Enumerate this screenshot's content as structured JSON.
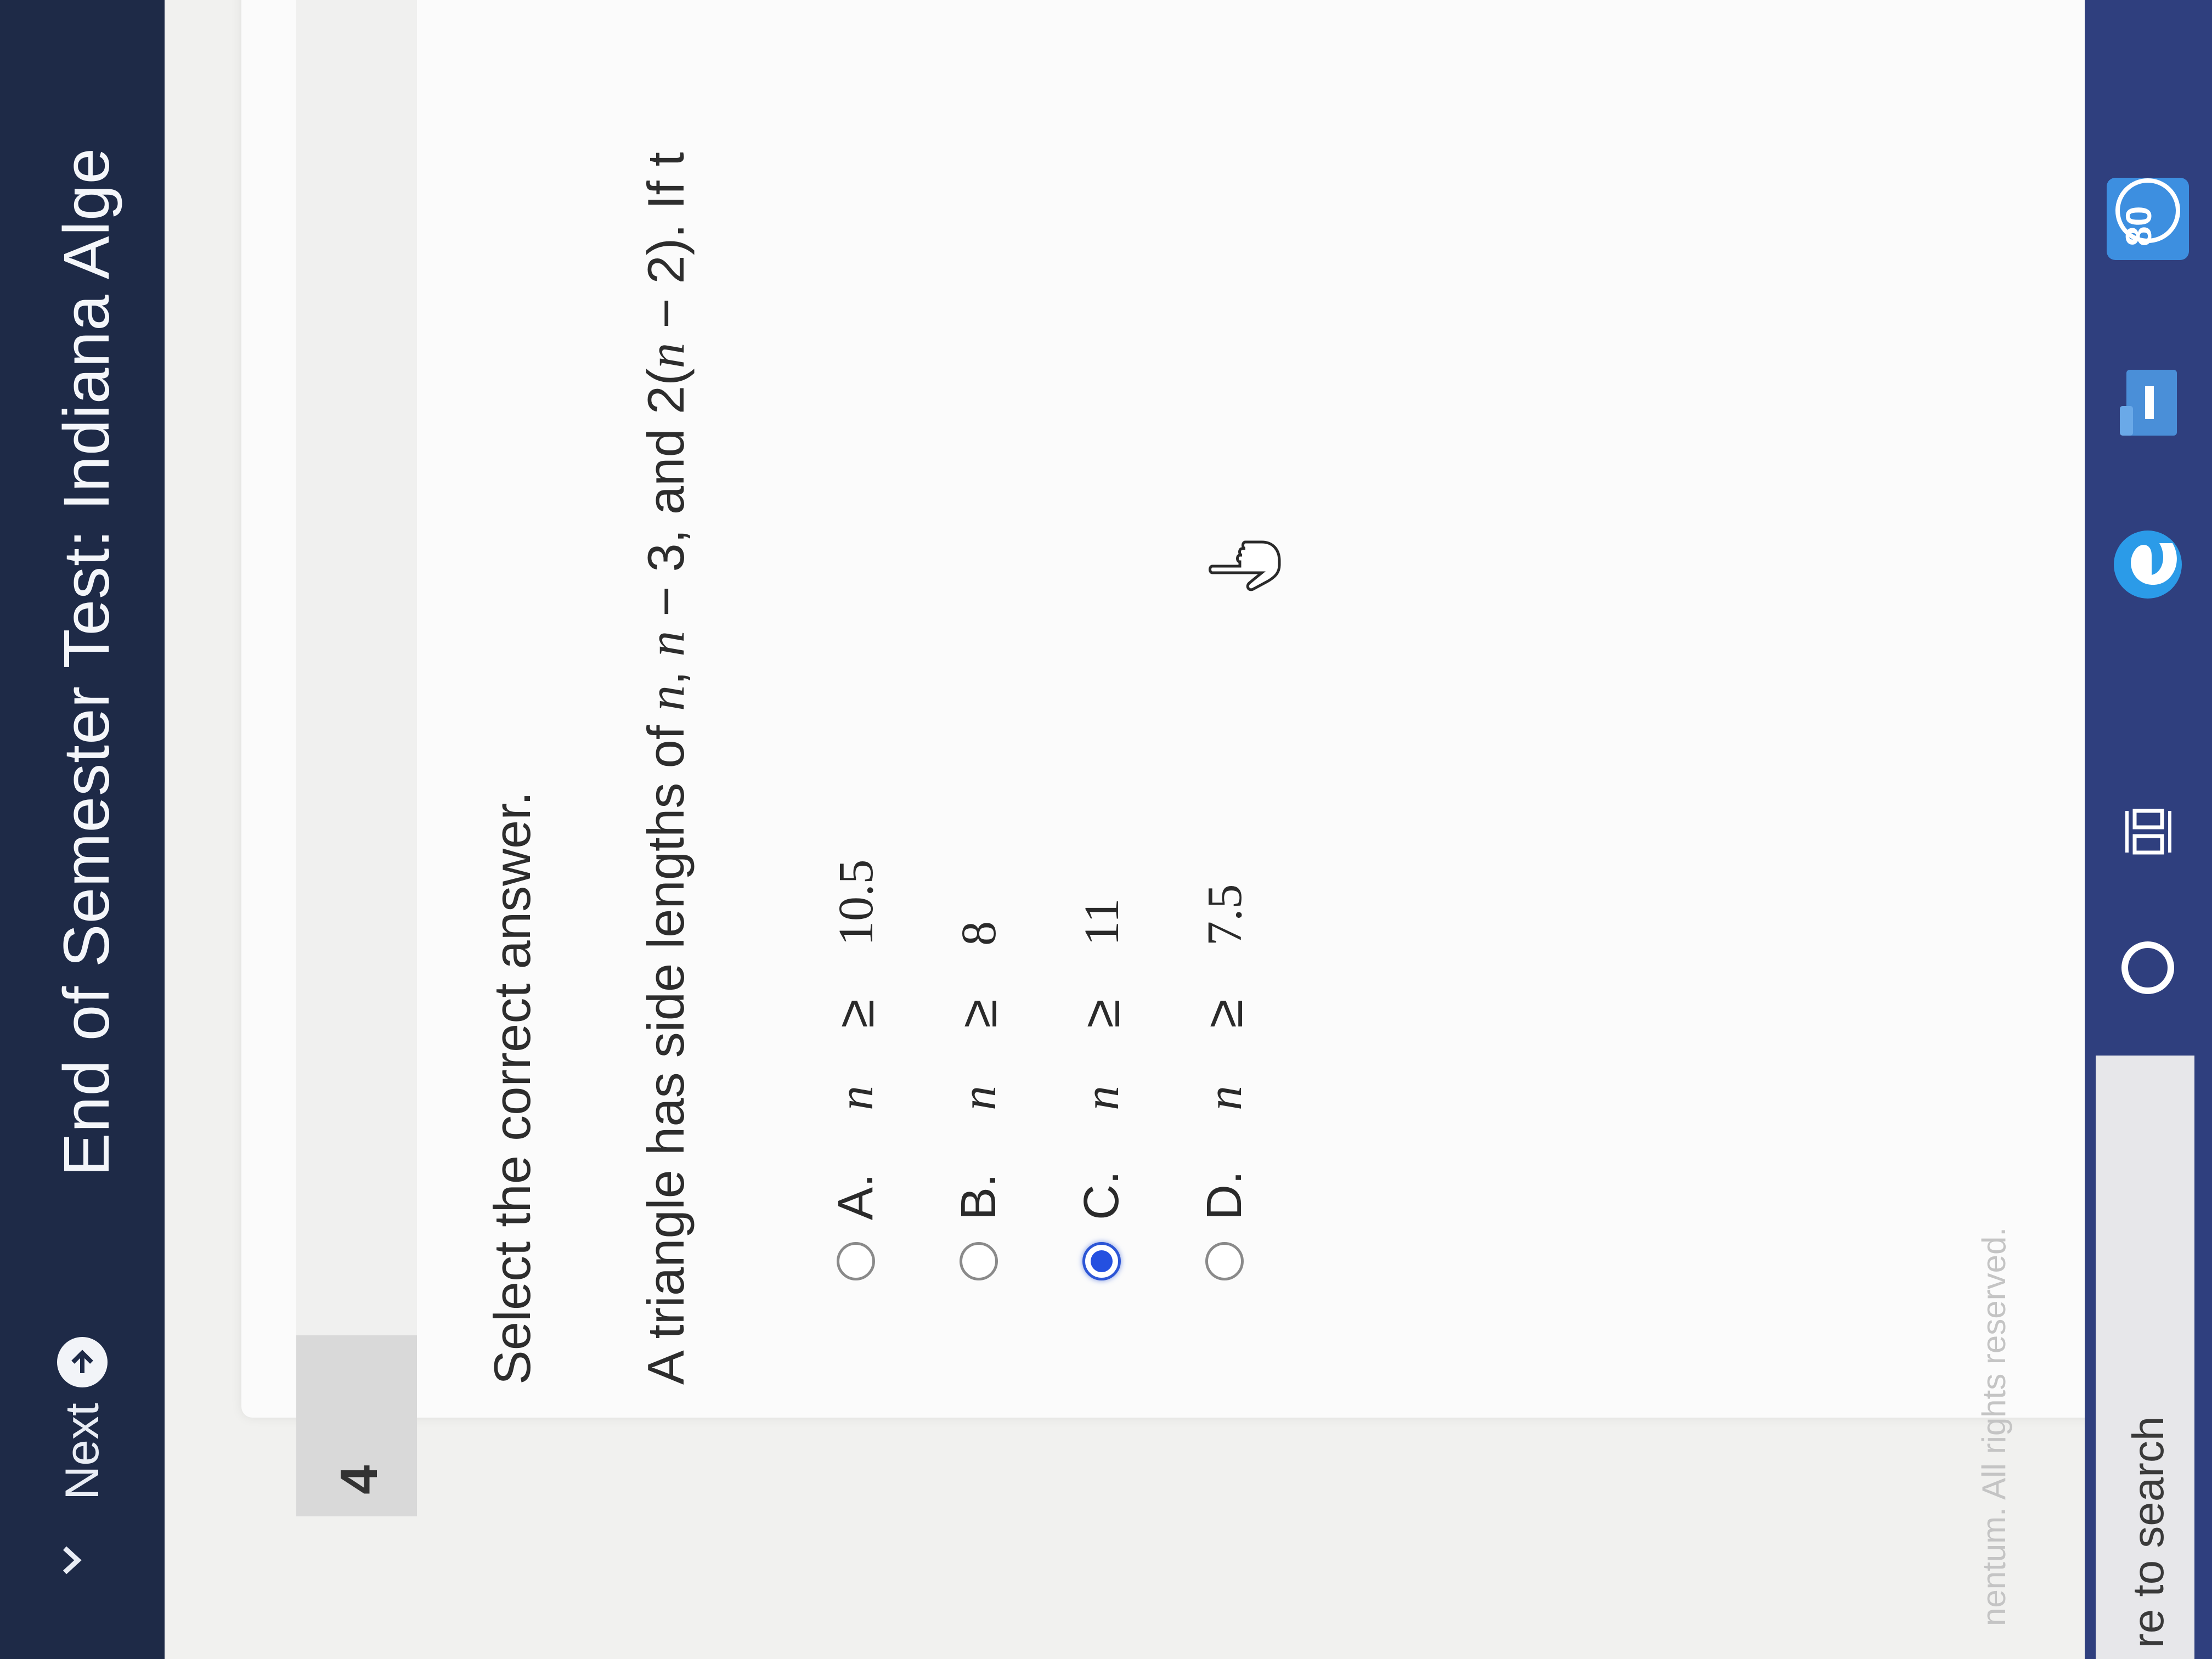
{
  "window": {
    "title": "End of Semester Test: Indiana Alge",
    "next_label": "Next"
  },
  "question": {
    "number": "4",
    "instruction": "Select the correct answer.",
    "prompt": {
      "lead": "A triangle has side lengths of ",
      "v1": "n",
      "sep1": ", ",
      "v2": "n",
      "expr2": " − 3, and 2(",
      "v3": "n",
      "expr3": " − 2). If t"
    },
    "options": [
      {
        "letter": "A.",
        "var": "n",
        "op": "≥",
        "value": "10.5",
        "selected": false
      },
      {
        "letter": "B.",
        "var": "n",
        "op": "≥",
        "value": "8",
        "selected": false
      },
      {
        "letter": "C.",
        "var": "n",
        "op": "≥",
        "value": "11",
        "selected": true
      },
      {
        "letter": "D.",
        "var": "n",
        "op": "≥",
        "value": "7.5",
        "selected": false
      }
    ]
  },
  "footer": {
    "copyright": "nentum. All rights reserved."
  },
  "taskbar": {
    "search_text": "re to search",
    "badge": "80"
  },
  "colors": {
    "nav_bg": "#1e2a47",
    "selected_radio": "#2450e0",
    "taskbar_bg": "#2f3f7e"
  }
}
